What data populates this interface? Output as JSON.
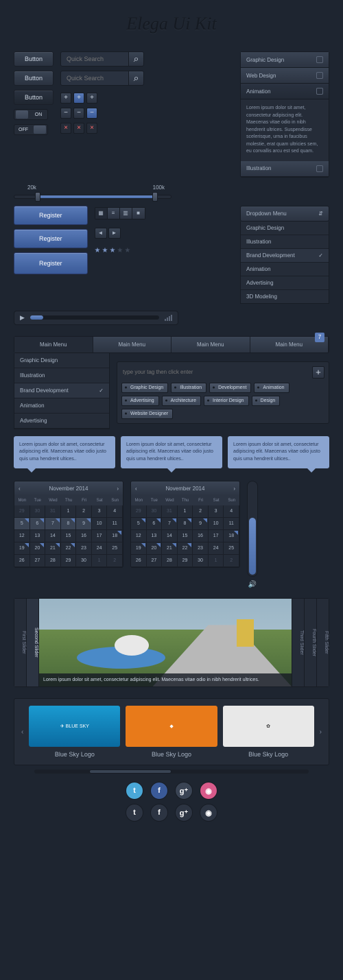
{
  "title": "Elega Ui Kit",
  "buttons": {
    "dark1": "Button",
    "dark2": "Button",
    "dark3": "Button"
  },
  "search": {
    "placeholder": "Quick Search"
  },
  "toggle": {
    "on": "ON",
    "off": "OFF"
  },
  "slider": {
    "min": "20k",
    "max": "100k"
  },
  "accordion": {
    "items": [
      "Graphic Design",
      "Web Design",
      "Animation",
      "Illustration"
    ],
    "body": "Lorem ipsum dolor sit amet, consectetur adipiscing elit. Maecenas vitae odio in nibh hendrerit ultrices. Suspendisse scelerisque, urna in faucibus molestie, erat quam ultricies sem, eu convallis arcu est sed quam."
  },
  "register": {
    "label": "Register"
  },
  "dropdown": {
    "label": "Dropdown Menu",
    "items": [
      "Graphic Design",
      "Illustration",
      "Brand Development",
      "Animation",
      "Advertising",
      "3D Modeling"
    ]
  },
  "mainmenu": {
    "label": "Main Menu",
    "badge": "7"
  },
  "submenu": [
    "Graphic Design",
    "Illustration",
    "Brand Development",
    "Animation",
    "Advertising"
  ],
  "taginput": {
    "placeholder": "type your tag then click enter"
  },
  "tags": [
    "Graphic Design",
    "Illustration",
    "Development",
    "Animation",
    "Advertising",
    "Architecture",
    "Interior Design",
    "Design",
    "Website Designer"
  ],
  "tooltip": "Lorem ipsum dolor sit amet, consectetur adipiscing elit. Maecenas vitae odio justo quis uma hendrerit ultices..",
  "calendar": {
    "month": "November 2014",
    "days": [
      "Mon",
      "Tue",
      "Wed",
      "Thu",
      "Fri",
      "Sat",
      "Sun"
    ],
    "cells": [
      29,
      30,
      31,
      1,
      2,
      3,
      4,
      5,
      6,
      7,
      8,
      9,
      10,
      11,
      12,
      13,
      14,
      15,
      16,
      17,
      18,
      19,
      20,
      21,
      22,
      23,
      24,
      25,
      26,
      27,
      28,
      29,
      30,
      1,
      2
    ]
  },
  "slider_widget": {
    "tabs": [
      "First Slider",
      "Second Slider",
      "Third Slider",
      "Fourth Slider",
      "Fifth Slider"
    ],
    "caption": "Lorem ipsum dolor sit amet, consectetur adipiscing elit. Maecenas vitae odio in nibh hendrerit ultrices."
  },
  "carousel": {
    "items": [
      "Blue Sky Logo",
      "Blue Sky Logo",
      "Blue Sky Logo"
    ]
  },
  "colors": {
    "accent": "#5a7bb8"
  }
}
